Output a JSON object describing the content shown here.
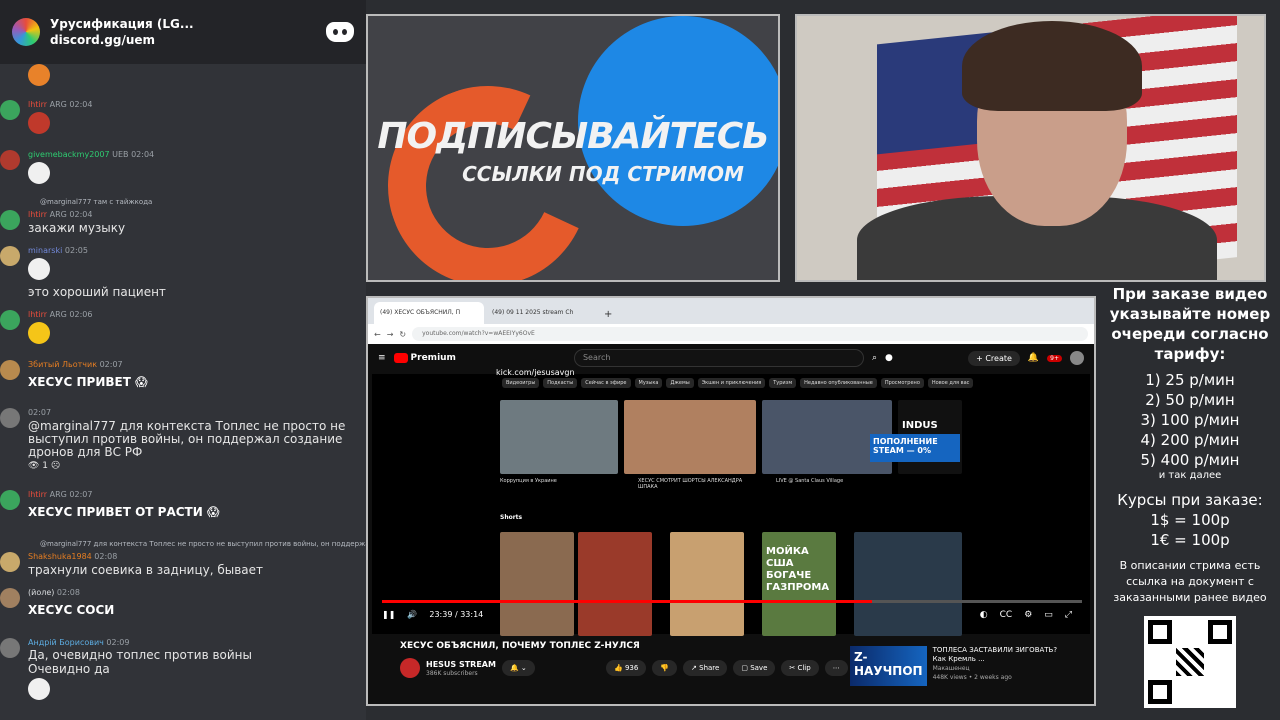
{
  "chat": {
    "server_name": "Урусификация (LG...",
    "invite": "discord.gg/uem",
    "messages": [
      {
        "id": "m1",
        "user": "lhtirr",
        "meta": "ARG 02:04",
        "text": "",
        "type": "emoji"
      },
      {
        "id": "m2",
        "user": "givemebackmy2007",
        "meta": "UEB 02:04",
        "text": "",
        "type": "emoji"
      },
      {
        "id": "m3",
        "reply": "@marginal777 там с тайжкода",
        "user": "lhtirr",
        "meta": "ARG 02:04",
        "text": "закажи музыку"
      },
      {
        "id": "m4",
        "user": "minarski",
        "meta": "02:05",
        "text": "это хороший пациент"
      },
      {
        "id": "m5",
        "user": "lhtirr",
        "meta": "ARG 02:06",
        "text": "",
        "type": "emoji"
      },
      {
        "id": "m6",
        "user": "Збитый Льотчик",
        "meta": "02:07",
        "text": "ХЕСУС ПРИВЕТ 😱"
      },
      {
        "id": "m7",
        "user": "",
        "meta": "02:07",
        "text": "@marginal777 для контекста Топлес не просто не",
        "text2": "выступил против войны, он поддержал создание",
        "text3": "дронов для ВС РФ",
        "reactions": "👁 1  ☹"
      },
      {
        "id": "m8",
        "user": "lhtirr",
        "meta": "ARG 02:07",
        "text": "ХЕСУС ПРИВЕТ ОТ РАСТИ 😱"
      },
      {
        "id": "m9",
        "reply": "@marginal777 для контекста Топлес не просто не выступил против войны, он поддержа",
        "user": "Shakshuka1984",
        "meta": "02:08",
        "text": "трахнули соевика в задницу, бывает"
      },
      {
        "id": "m10",
        "user": "(йоле)",
        "meta": "02:08",
        "text": "ХЕСУС СОСИ"
      },
      {
        "id": "m11",
        "user": "Андрій Борисович",
        "meta": "02:09",
        "text": "Да, очевидно топлес против войны",
        "text2": "Очевидно да"
      }
    ]
  },
  "promo": {
    "title": "ПОДПИСЫВАЙТЕСЬ",
    "subtitle": "ССЫЛКИ ПОД СТРИМОМ"
  },
  "browser": {
    "tab1": "(49) ХЕСУС ОБЪЯСНИЛ, П",
    "tab2": "(49) 09 11 2025 stream Ch",
    "url": "youtube.com/watch?v=wAEEIYy6OvE",
    "yt_brand": "Premium",
    "search_placeholder": "Search",
    "create": "+ Create",
    "notif_count": "9+",
    "overlay_url": "kick.com/jesusavgn",
    "chips": [
      "Видеоигры",
      "Подкасты",
      "Сейчас в эфире",
      "Музыка",
      "Джемы",
      "Экшен и приключения",
      "Туризм",
      "Недавно опубликованные",
      "Просмотрено",
      "Новое для вас"
    ],
    "shorts_label": "Shorts",
    "time": "23:39 / 33:14",
    "video_title": "ХЕСУС ОБЪЯСНИЛ, ПОЧЕМУ ТОПЛЕС Z-НУЛСЯ",
    "channel": "HESUS STREAM",
    "subs": "386K subscribers",
    "likes": "936",
    "share": "Share",
    "save": "Save",
    "clip": "Clip",
    "rec_title": "ТОПЛЕСА ЗАСТАВИЛИ ЗИГОВАТЬ? Как Кремль ...",
    "rec_channel": "Макашенец",
    "rec_views": "448K views • 2 weeks ago",
    "rec_thumb_text": "Z-НАУЧПОП",
    "thumb_labels": [
      "Коррупция в Украине",
      "ХЕСУС СМОТРИТ ШОРТСЫ АЛЕКСАНДРА ШПАКА",
      "LIVE @ Santa Claus Village"
    ],
    "short_text": "МОЙКА США БОГАЧЕ ГАЗПРОМА",
    "donate": "ПОПОЛНЕНИЕ STEAM — 0%"
  },
  "info": {
    "head": "При заказе видео указывайте номер очереди согласно тарифу:",
    "tariffs": [
      "1) 25 р/мин",
      "2) 50 р/мин",
      "3) 100 р/мин",
      "4) 200 р/мин",
      "5) 400 р/мин"
    ],
    "etc": "и так далее",
    "courses_head": "Курсы при заказе:",
    "usd": "1$ = 100р",
    "eur": "1€ = 100р",
    "foot": "В описании стрима есть ссылка на документ с заказанными ранее видео"
  }
}
